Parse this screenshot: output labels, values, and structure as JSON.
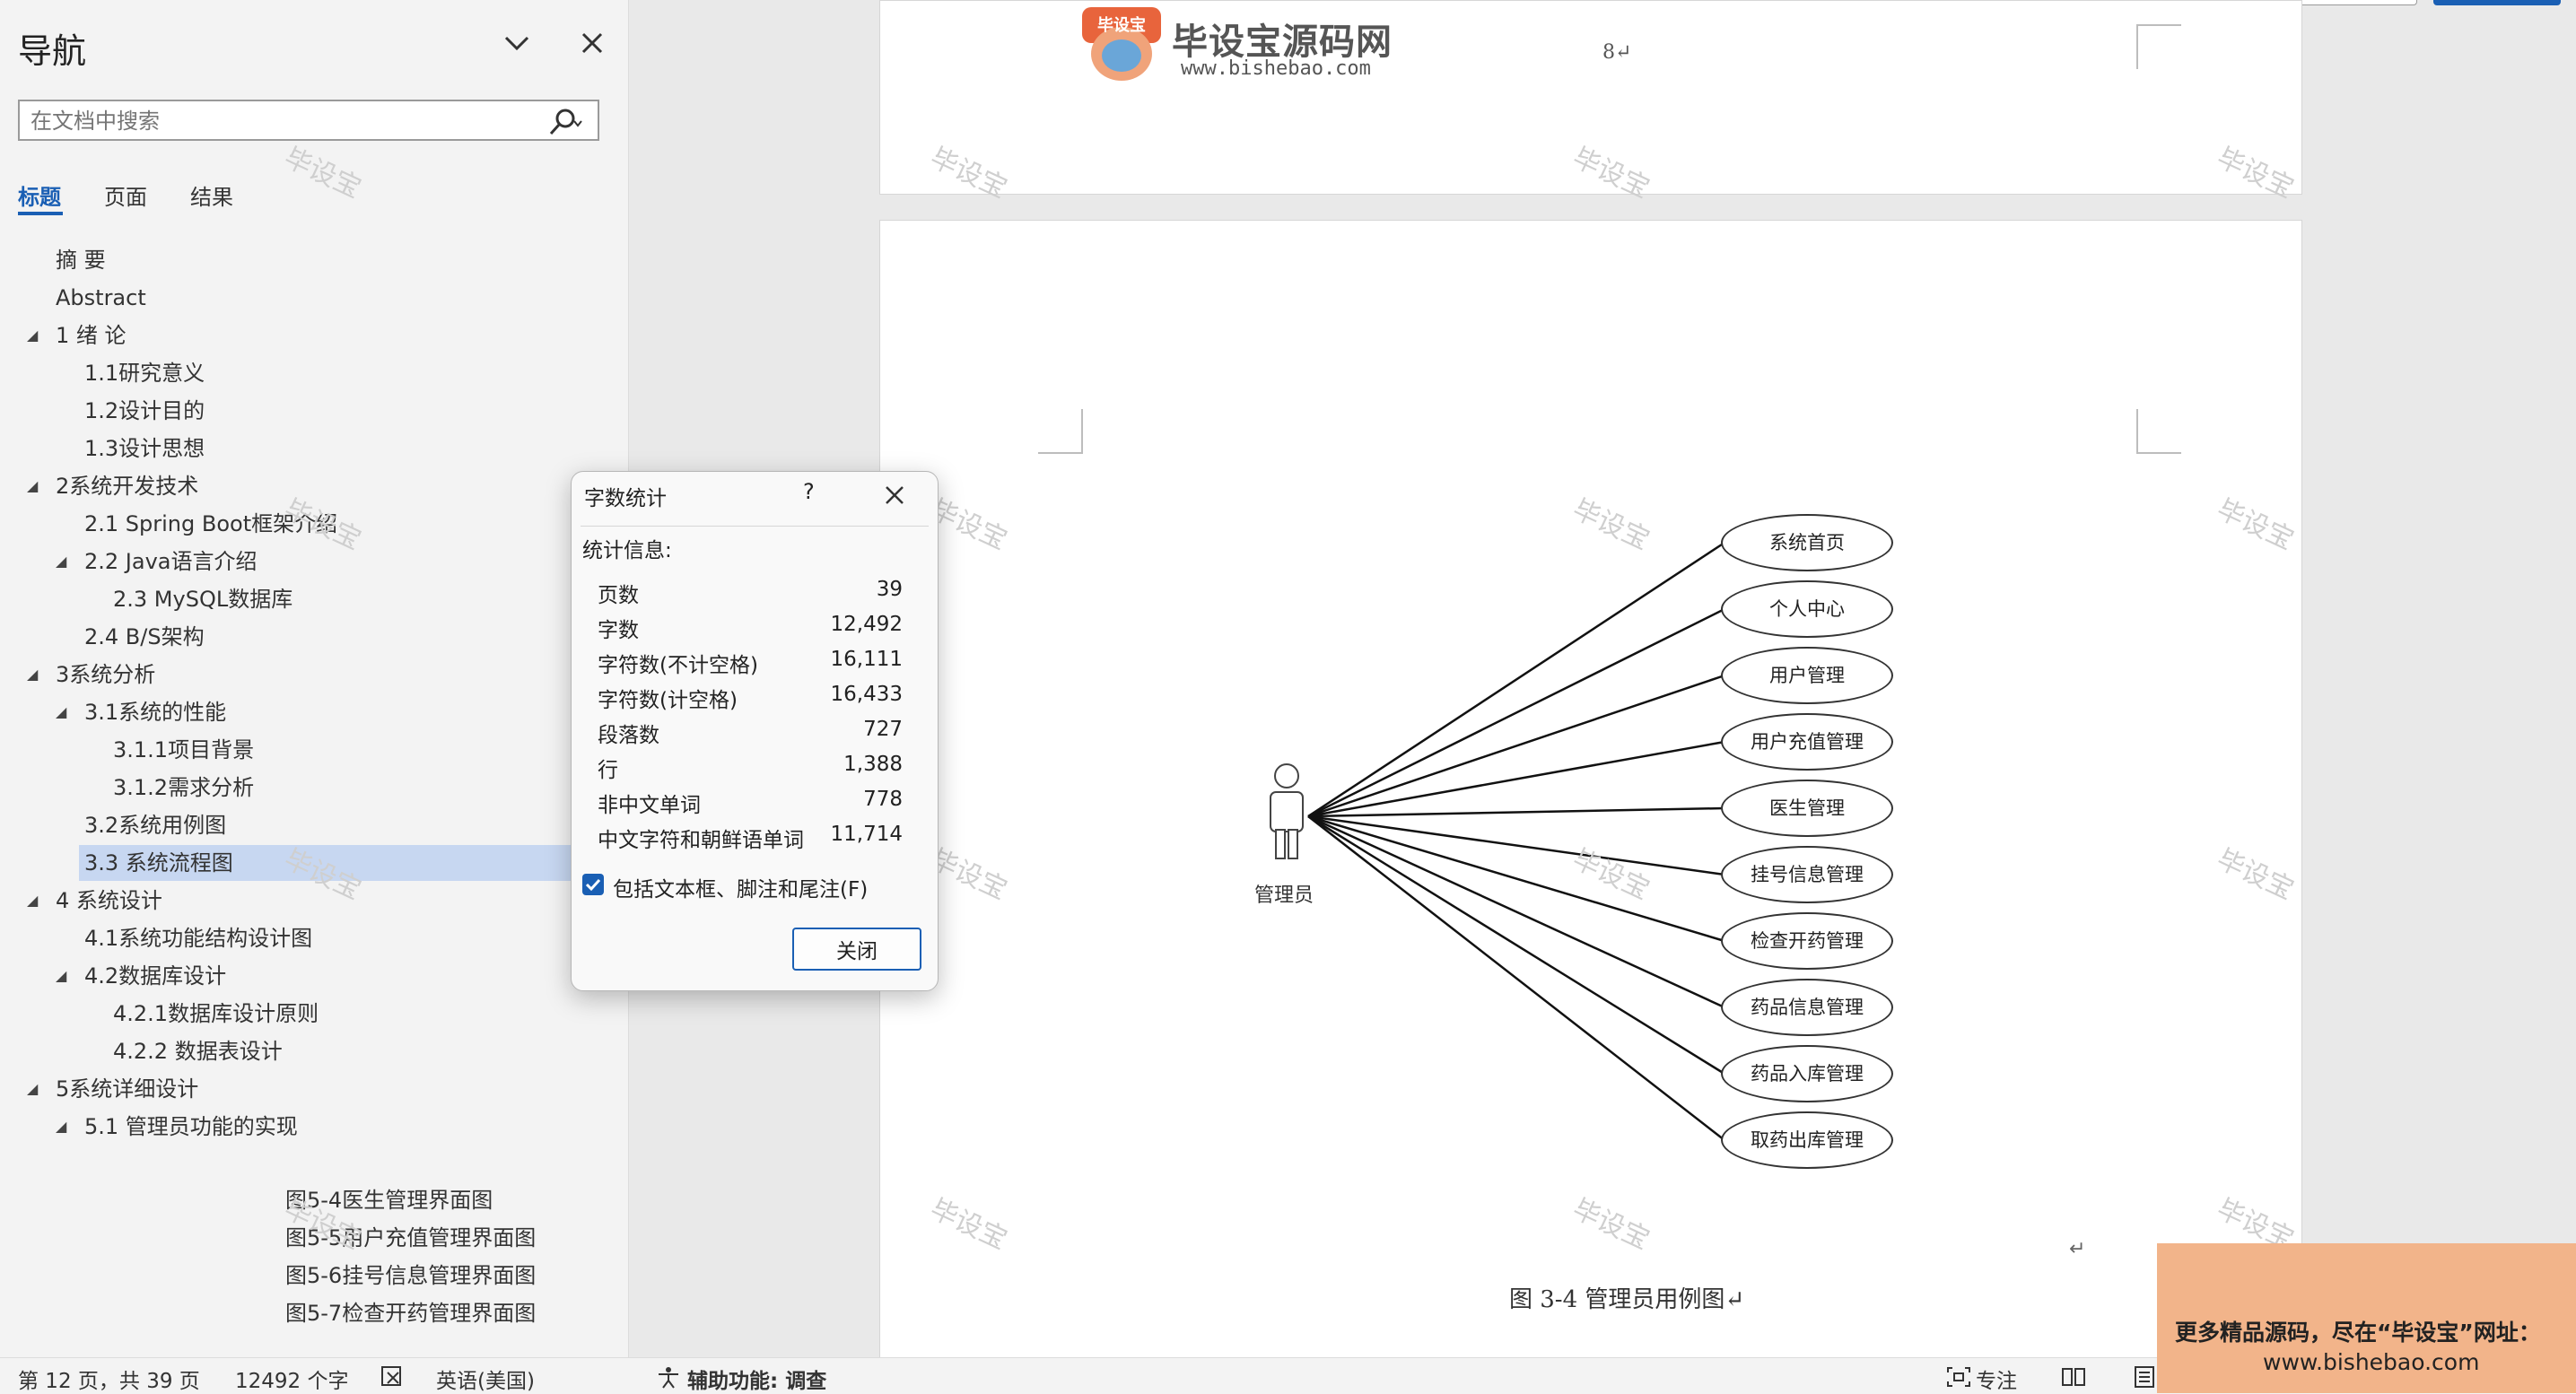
{
  "nav": {
    "title": "导航",
    "search_placeholder": "在文档中搜索",
    "tabs": [
      "标题",
      "页面",
      "结果"
    ],
    "items": [
      {
        "label": "摘  要",
        "level": 1,
        "expanded": null
      },
      {
        "label": "Abstract",
        "level": 1,
        "expanded": null
      },
      {
        "label": "1 绪  论",
        "level": 1,
        "expanded": true
      },
      {
        "label": "1.1研究意义",
        "level": 2,
        "expanded": null
      },
      {
        "label": "1.2设计目的",
        "level": 2,
        "expanded": null
      },
      {
        "label": "1.3设计思想",
        "level": 2,
        "expanded": null
      },
      {
        "label": "2系统开发技术",
        "level": 1,
        "expanded": true
      },
      {
        "label": "2.1 Spring Boot框架介绍",
        "level": 2,
        "expanded": null
      },
      {
        "label": "2.2 Java语言介绍",
        "level": 2,
        "expanded": true
      },
      {
        "label": "2.3 MySQL数据库",
        "level": 3,
        "expanded": null
      },
      {
        "label": "2.4 B/S架构",
        "level": 2,
        "expanded": null
      },
      {
        "label": "3系统分析",
        "level": 1,
        "expanded": true
      },
      {
        "label": "3.1系统的性能",
        "level": 2,
        "expanded": true
      },
      {
        "label": "3.1.1项目背景",
        "level": 3,
        "expanded": null
      },
      {
        "label": "3.1.2需求分析",
        "level": 3,
        "expanded": null
      },
      {
        "label": "3.2系统用例图",
        "level": 2,
        "expanded": null
      },
      {
        "label": "3.3 系统流程图",
        "level": 2,
        "expanded": null,
        "selected": true
      },
      {
        "label": "4 系统设计",
        "level": 1,
        "expanded": true
      },
      {
        "label": "4.1系统功能结构设计图",
        "level": 2,
        "expanded": null
      },
      {
        "label": "4.2数据库设计",
        "level": 2,
        "expanded": true
      },
      {
        "label": "4.2.1数据库设计原则",
        "level": 3,
        "expanded": null
      },
      {
        "label": "4.2.2  数据表设计",
        "level": 3,
        "expanded": null
      },
      {
        "label": "5系统详细设计",
        "level": 1,
        "expanded": true
      },
      {
        "label": "5.1 管理员功能的实现",
        "level": 2,
        "expanded": true
      }
    ],
    "figures": [
      "图5-4医生管理界面图",
      "图5-5用户充值管理界面图",
      "图5-6挂号信息管理界面图",
      "图5-7检查开药管理界面图"
    ]
  },
  "watermark": "毕设宝",
  "logo": {
    "title": "毕设宝源码网",
    "url": "www.bishebao.com",
    "badge_text": "毕设宝"
  },
  "doc": {
    "page_number": "8↵",
    "actor": "管理员",
    "use_cases": [
      "系统首页",
      "个人中心",
      "用户管理",
      "用户充值管理",
      "医生管理",
      "挂号信息管理",
      "检查开药管理",
      "药品信息管理",
      "药品入库管理",
      "取药出库管理"
    ],
    "caption": "图 3-4  管理员用例图↵",
    "para_mark": "↵"
  },
  "dialog": {
    "title": "字数统计",
    "help": "?",
    "section": "统计信息:",
    "stats": [
      {
        "label": "页数",
        "value": "39"
      },
      {
        "label": "字数",
        "value": "12,492"
      },
      {
        "label": "字符数(不计空格)",
        "value": "16,111"
      },
      {
        "label": "字符数(计空格)",
        "value": "16,433"
      },
      {
        "label": "段落数",
        "value": "727"
      },
      {
        "label": "行",
        "value": "1,388"
      },
      {
        "label": "非中文单词",
        "value": "778"
      },
      {
        "label": "中文字符和朝鲜语单词",
        "value": "11,714"
      }
    ],
    "checkbox_label": "包括文本框、脚注和尾注(F)",
    "checkbox_checked": true,
    "close_label": "关闭"
  },
  "status": {
    "page": "第 12 页，共 39 页",
    "words": "12492 个字",
    "language": "英语(美国)",
    "accessibility": "辅助功能: 调查",
    "focus": "专注"
  },
  "promo": {
    "line1": "更多精品源码，尽在“毕设宝”网址：",
    "line2": "www.bishebao.com"
  },
  "colors": {
    "accent": "#1a5fb4",
    "selection": "#c7d7f1",
    "promo": "#f2b48a",
    "badge": "#e8643c"
  }
}
